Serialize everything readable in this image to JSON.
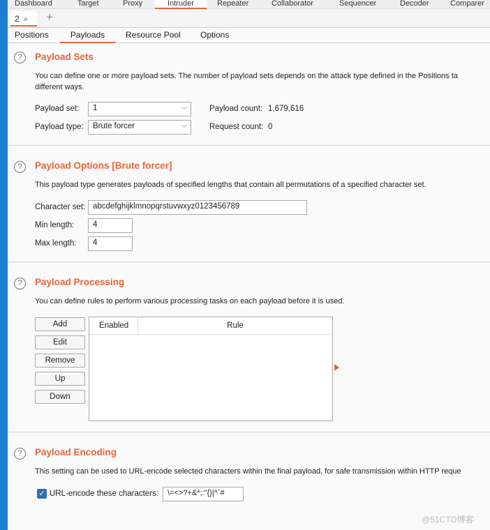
{
  "top_tabs": [
    "Dashboard",
    "Target",
    "Proxy",
    "Intruder",
    "Repeater",
    "Collaborator",
    "Sequencer",
    "Decoder",
    "Comparer"
  ],
  "active_top_tab": "Intruder",
  "attack_tab": {
    "label": "2",
    "close": "×",
    "add": "+"
  },
  "payload_tabs": [
    "Positions",
    "Payloads",
    "Resource Pool",
    "Options"
  ],
  "active_payload_tab": "Payloads",
  "help_glyph": "?",
  "payload_sets": {
    "title": "Payload Sets",
    "description": "You can define one or more payload sets. The number of payload sets depends on the attack type defined in the Positions ta",
    "description2": "different ways.",
    "set_label": "Payload set:",
    "set_value": "1",
    "type_label": "Payload type:",
    "type_value": "Brute forcer",
    "count_label": "Payload count:",
    "count_value": "1,679,616",
    "request_label": "Request count:",
    "request_value": "0"
  },
  "payload_options": {
    "title": "Payload Options [Brute forcer]",
    "description": "This payload type generates payloads of specified lengths that contain all permutations of a specified character set.",
    "charset_label": "Character set:",
    "charset_value": "abcdefghijklmnopqrstuvwxyz0123456789",
    "min_label": "Min length:",
    "min_value": "4",
    "max_label": "Max length:",
    "max_value": "4"
  },
  "payload_processing": {
    "title": "Payload Processing",
    "description": "You can define rules to perform various processing tasks on each payload before it is used.",
    "buttons": [
      "Add",
      "Edit",
      "Remove",
      "Up",
      "Down"
    ],
    "columns": [
      "Enabled",
      "Rule"
    ]
  },
  "payload_encoding": {
    "title": "Payload Encoding",
    "description": "This setting can be used to URL-encode selected characters within the final payload, for safe transmission within HTTP reque",
    "checkbox_label": "URL-encode these characters:",
    "checked": true,
    "chars_value": "\\=<>?+&*;:\"{}|^`#"
  },
  "watermark": "@51CTO博客",
  "colors": {
    "accent": "#e8643a",
    "checkbox": "#2d6db5"
  }
}
